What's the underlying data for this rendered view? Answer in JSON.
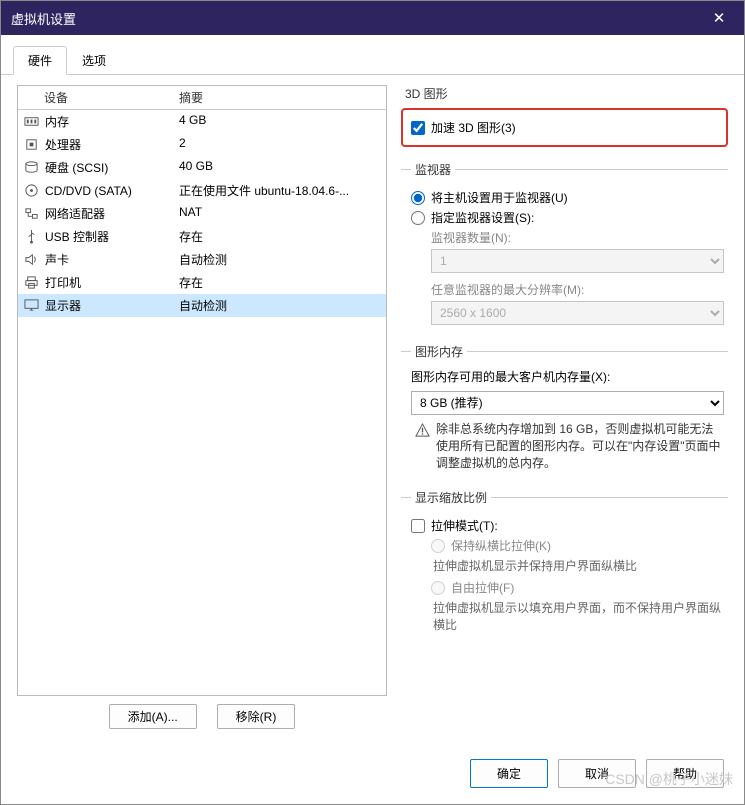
{
  "window": {
    "title": "虚拟机设置"
  },
  "tabs": {
    "hardware": "硬件",
    "options": "选项"
  },
  "device_table": {
    "col_device": "设备",
    "col_summary": "摘要",
    "rows": [
      {
        "icon": "memory",
        "name": "内存",
        "summary": "4 GB"
      },
      {
        "icon": "cpu",
        "name": "处理器",
        "summary": "2"
      },
      {
        "icon": "disk",
        "name": "硬盘 (SCSI)",
        "summary": "40 GB"
      },
      {
        "icon": "cd",
        "name": "CD/DVD (SATA)",
        "summary": "正在使用文件 ubuntu-18.04.6-..."
      },
      {
        "icon": "net",
        "name": "网络适配器",
        "summary": "NAT"
      },
      {
        "icon": "usb",
        "name": "USB 控制器",
        "summary": "存在"
      },
      {
        "icon": "sound",
        "name": "声卡",
        "summary": "自动检测"
      },
      {
        "icon": "printer",
        "name": "打印机",
        "summary": "存在"
      },
      {
        "icon": "display",
        "name": "显示器",
        "summary": "自动检测",
        "selected": true
      }
    ]
  },
  "left_actions": {
    "add": "添加(A)...",
    "remove": "移除(R)"
  },
  "panels": {
    "d3": {
      "legend": "3D 图形",
      "accel": "加速 3D 图形(3)"
    },
    "monitor": {
      "legend": "监视器",
      "use_host": "将主机设置用于监视器(U)",
      "specify": "指定监视器设置(S):",
      "count_label": "监视器数量(N):",
      "count_value": "1",
      "max_res_label": "任意监视器的最大分辨率(M):",
      "max_res_value": "2560 x 1600"
    },
    "gmem": {
      "legend": "图形内存",
      "label": "图形内存可用的最大客户机内存量(X):",
      "value": "8 GB (推荐)",
      "warning": "除非总系统内存增加到 16 GB，否则虚拟机可能无法使用所有已配置的图形内存。可以在\"内存设置\"页面中调整虚拟机的总内存。"
    },
    "scale": {
      "legend": "显示缩放比例",
      "stretch_mode": "拉伸模式(T):",
      "keep_ratio": "保持纵横比拉伸(K)",
      "keep_ratio_desc": "拉伸虚拟机显示并保持用户界面纵横比",
      "free": "自由拉伸(F)",
      "free_desc": "拉伸虚拟机显示以填充用户界面，而不保持用户界面纵横比"
    }
  },
  "footer": {
    "ok": "确定",
    "cancel": "取消",
    "help": "帮助"
  },
  "watermark": "CSDN @桃子小迷妹"
}
